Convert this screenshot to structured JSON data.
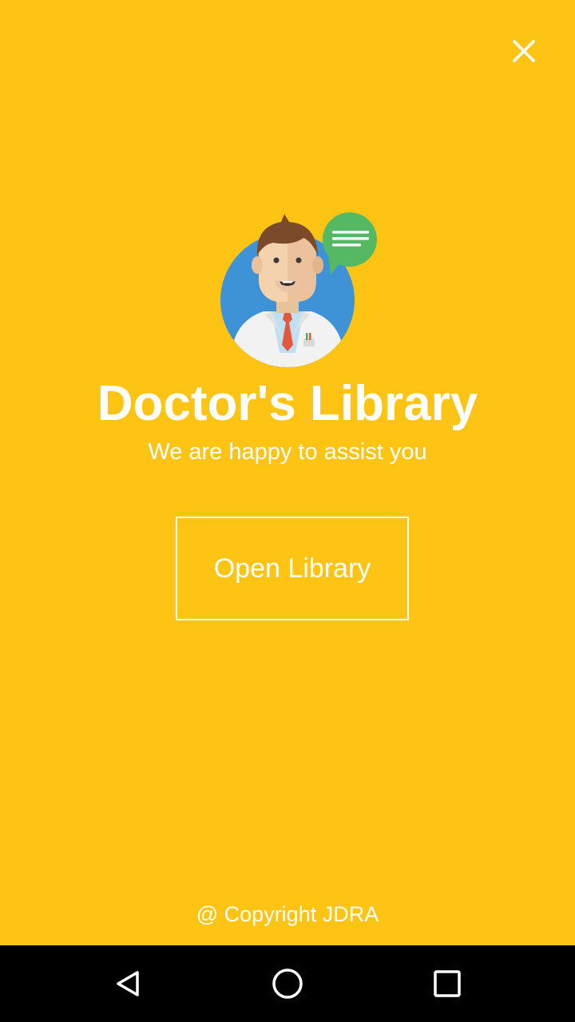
{
  "app": {
    "title": "Doctor's Library",
    "subtitle": "We are happy to assist you",
    "open_button_label": "Open Library",
    "copyright": "@ Copyright JDRA",
    "background_color": "#FEC413",
    "icons": {
      "close": "close-icon",
      "avatar": "doctor-avatar-icon",
      "chat": "chat-bubble-icon"
    }
  },
  "nav_bar": {
    "icons": [
      "back-icon",
      "home-icon",
      "recents-icon"
    ]
  }
}
